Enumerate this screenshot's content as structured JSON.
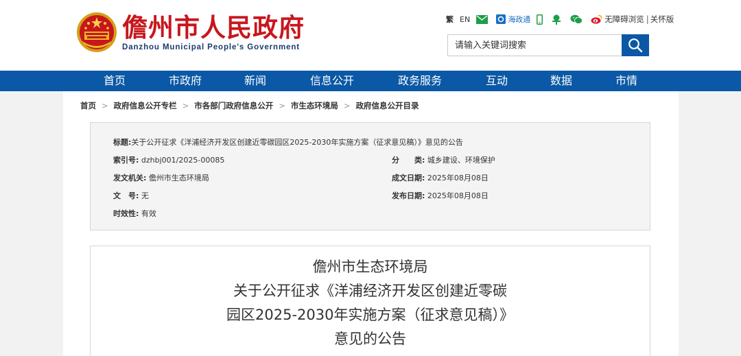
{
  "header": {
    "site_title": "儋州市人民政府",
    "site_subtitle": "Danzhou Municipal People's Government",
    "toplinks": {
      "traditional": "繁",
      "english": "EN",
      "hainan_gov": "海政通",
      "accessibility": "无障碍浏览",
      "care": "关怀版",
      "separator": "|"
    },
    "search": {
      "placeholder": "请输入关键词搜索"
    }
  },
  "nav": {
    "items": [
      "首页",
      "市政府",
      "新闻",
      "信息公开",
      "政务服务",
      "互动",
      "数据",
      "市情"
    ]
  },
  "breadcrumb": {
    "items": [
      "首页",
      "政府信息公开专栏",
      "市各部门政府信息公开",
      "市生态环境局",
      "政府信息公开目录"
    ],
    "separator": ">"
  },
  "info": {
    "title_label": "标题:",
    "title_value": "关于公开征求《洋浦经济开发区创建近零碳园区2025-2030年实施方案（征求意见稿）》意见的公告",
    "index_label": "索引号:",
    "index_value": "dzhbj001/2025-00085",
    "category_label": "分　　类:",
    "category_value": "城乡建设、环境保护",
    "issuer_label": "发文机关:",
    "issuer_value": "儋州市生态环境局",
    "created_label": "成文日期:",
    "created_value": "2025年08月08日",
    "docno_label": "文　号:",
    "docno_value": "无",
    "published_label": "发布日期:",
    "published_value": "2025年08月08日",
    "validity_label": "时效性:",
    "validity_value": "有效"
  },
  "document": {
    "title_lines": [
      "儋州市生态环境局",
      "关于公开征求《洋浦经济开发区创建近零碳",
      "园区2025-2030年实施方案（征求意见稿）》",
      "意见的公告"
    ]
  },
  "colors": {
    "brand_red": "#c8161d",
    "nav_blue": "#0a58a6",
    "subtitle_navy": "#1b3a6b",
    "side_gray": "#f2f2f2"
  }
}
